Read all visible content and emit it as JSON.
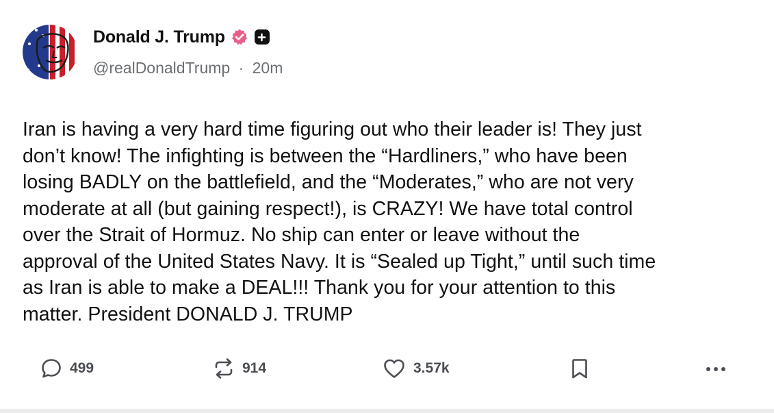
{
  "post": {
    "author": {
      "display_name": "Donald J. Trump",
      "handle": "@realDonaldTrump",
      "separator": "·",
      "time": "20m",
      "verified_icon": "verified-badge-icon",
      "verified_color": "#e75480",
      "plus_badge_icon": "plus-badge-icon"
    },
    "text_lines": [
      "Iran is having a very hard time figuring out who their leader is! They just",
      "don’t know! The infighting is between the “Hardliners,” who have been",
      "losing BADLY on the battlefield, and the “Moderates,” who are not very",
      "moderate at all (but gaining respect!), is CRAZY! We have total control",
      "over the Strait of Hormuz. No ship can enter or leave without the",
      "approval of the United States Navy. It is “Sealed up Tight,” until such time",
      "as Iran is able to make a DEAL!!! Thank you for your attention to this",
      "matter. President DONALD J. TRUMP"
    ],
    "actions": {
      "reply": {
        "icon": "comment-icon",
        "count": "499"
      },
      "repost": {
        "icon": "repost-icon",
        "count": "914"
      },
      "like": {
        "icon": "heart-icon",
        "count": "3.57k"
      },
      "bookmark": {
        "icon": "bookmark-icon"
      },
      "more": {
        "icon": "more-options-icon"
      }
    }
  }
}
